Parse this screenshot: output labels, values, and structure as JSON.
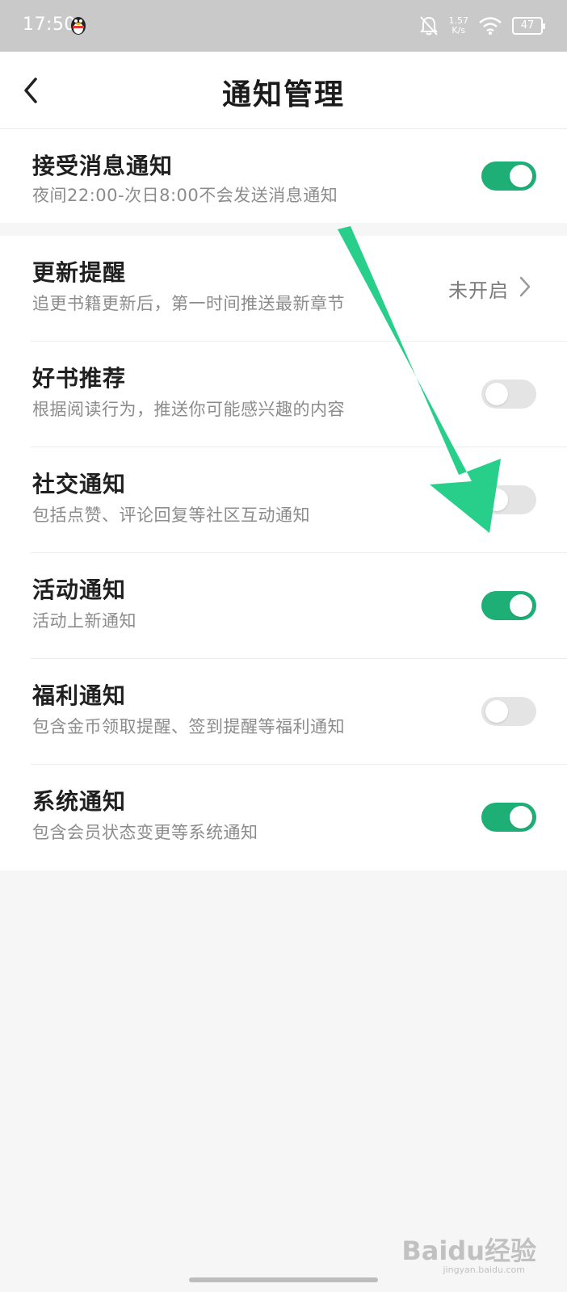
{
  "status_bar": {
    "time": "17:50",
    "network_speed_value": "1.57",
    "network_speed_unit": "K/s",
    "battery": "47",
    "icons": [
      "qq-penguin-icon",
      "bell-off-icon",
      "wifi-icon",
      "battery-icon"
    ]
  },
  "header": {
    "title": "通知管理",
    "back_icon": "chevron-left-icon"
  },
  "settings": {
    "receive": {
      "label": "接受消息通知",
      "desc": "夜间22:00-次日8:00不会发送消息通知",
      "enabled": true
    },
    "update": {
      "label": "更新提醒",
      "desc": "追更书籍更新后，第一时间推送最新章节",
      "status": "未开启"
    },
    "recommend": {
      "label": "好书推荐",
      "desc": "根据阅读行为，推送你可能感兴趣的内容",
      "enabled": false
    },
    "social": {
      "label": "社交通知",
      "desc": "包括点赞、评论回复等社区互动通知",
      "enabled": false
    },
    "activity": {
      "label": "活动通知",
      "desc": "活动上新通知",
      "enabled": true
    },
    "welfare": {
      "label": "福利通知",
      "desc": "包含金币领取提醒、签到提醒等福利通知",
      "enabled": false
    },
    "system": {
      "label": "系统通知",
      "desc": "包含会员状态变更等系统通知",
      "enabled": true
    }
  },
  "colors": {
    "toggle_on": "#1eaf77",
    "toggle_off": "#e4e4e4",
    "annotation_arrow": "#27cf8a",
    "background": "#f6f6f6"
  },
  "watermark": {
    "logo": "Baidu经验",
    "url": "jingyan.baidu.com"
  }
}
